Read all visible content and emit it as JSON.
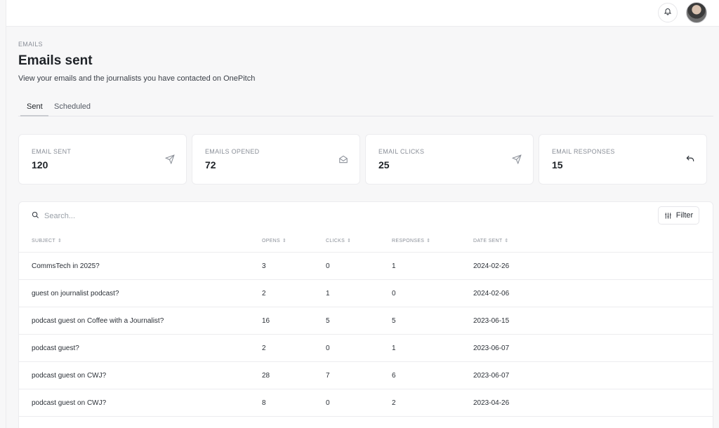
{
  "header": {
    "notifications_icon": "bell-icon",
    "avatar_icon": "user-avatar"
  },
  "breadcrumb": "EMAILS",
  "page": {
    "title": "Emails sent",
    "subtitle": "View your emails and the journalists you have contacted on OnePitch"
  },
  "tabs": [
    {
      "label": "Sent",
      "active": true
    },
    {
      "label": "Scheduled",
      "active": false
    }
  ],
  "stats": [
    {
      "label": "EMAIL SENT",
      "value": "120",
      "icon": "send-icon"
    },
    {
      "label": "EMAILS OPENED",
      "value": "72",
      "icon": "envelope-open-icon"
    },
    {
      "label": "EMAIL CLICKS",
      "value": "25",
      "icon": "send-icon"
    },
    {
      "label": "EMAIL RESPONSES",
      "value": "15",
      "icon": "reply-icon"
    }
  ],
  "table": {
    "search_placeholder": "Search...",
    "filter_label": "Filter",
    "columns": [
      "SUBJECT",
      "OPENS",
      "CLICKS",
      "RESPONSES",
      "DATE SENT"
    ],
    "rows": [
      {
        "subject": "CommsTech in 2025?",
        "opens": "3",
        "clicks": "0",
        "responses": "1",
        "date": "2024-02-26"
      },
      {
        "subject": "guest on journalist podcast?",
        "opens": "2",
        "clicks": "1",
        "responses": "0",
        "date": "2024-02-06"
      },
      {
        "subject": "podcast guest on Coffee with a Journalist?",
        "opens": "16",
        "clicks": "5",
        "responses": "5",
        "date": "2023-06-15"
      },
      {
        "subject": "podcast guest?",
        "opens": "2",
        "clicks": "0",
        "responses": "1",
        "date": "2023-06-07"
      },
      {
        "subject": "podcast guest on CWJ?",
        "opens": "28",
        "clicks": "7",
        "responses": "6",
        "date": "2023-06-07"
      },
      {
        "subject": "podcast guest on CWJ?",
        "opens": "8",
        "clicks": "0",
        "responses": "2",
        "date": "2023-04-26"
      }
    ]
  }
}
